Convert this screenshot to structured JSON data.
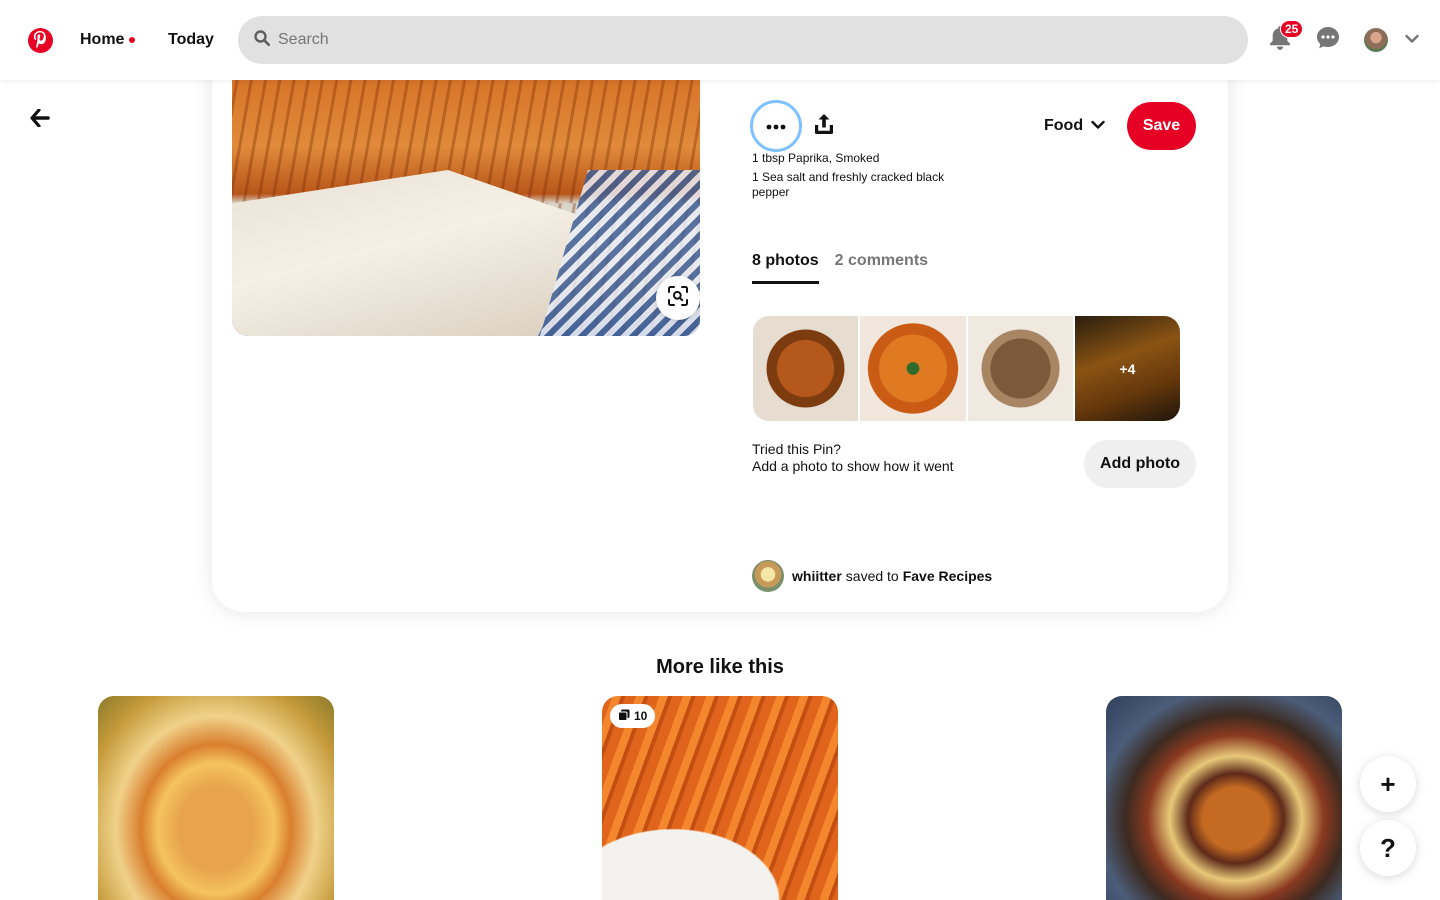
{
  "header": {
    "home_label": "Home",
    "today_label": "Today",
    "search_placeholder": "Search",
    "notification_count": "25",
    "accent_color": "#e60023"
  },
  "icons": {
    "logo": "pinterest-logo-icon",
    "search": "search-icon",
    "bell": "bell-icon",
    "chat": "chat-icon",
    "chevron": "chevron-down-icon",
    "back": "arrow-left-icon",
    "more": "ellipsis-icon",
    "share": "share-upload-icon",
    "lens": "visual-search-icon",
    "plus": "plus-icon",
    "help": "question-mark-icon",
    "stack": "multi-image-icon"
  },
  "pin": {
    "board_name": "Food",
    "save_label": "Save",
    "ingredients": [
      "1 tbsp Paprika, Smoked",
      "1 Sea salt and freshly cracked black pepper"
    ],
    "tabs": [
      {
        "label": "8 photos",
        "active": true
      },
      {
        "label": "2 comments",
        "active": false
      }
    ],
    "extra_photos_label": "+4",
    "tried_title": "Tried this Pin?",
    "tried_subtitle": "Add a photo to show how it went",
    "add_photo_label": "Add photo",
    "saver": {
      "username": "whiitter",
      "action": "saved to",
      "board": "Fave Recipes"
    }
  },
  "more_like_this": {
    "title": "More like this",
    "cards": [
      {
        "image": "cheesy-pasta"
      },
      {
        "image": "roasted-carrots",
        "photo_count": "10"
      },
      {
        "image": "hasselback-vegetables"
      }
    ]
  },
  "floating": {
    "plus_label": "+",
    "help_label": "?"
  }
}
